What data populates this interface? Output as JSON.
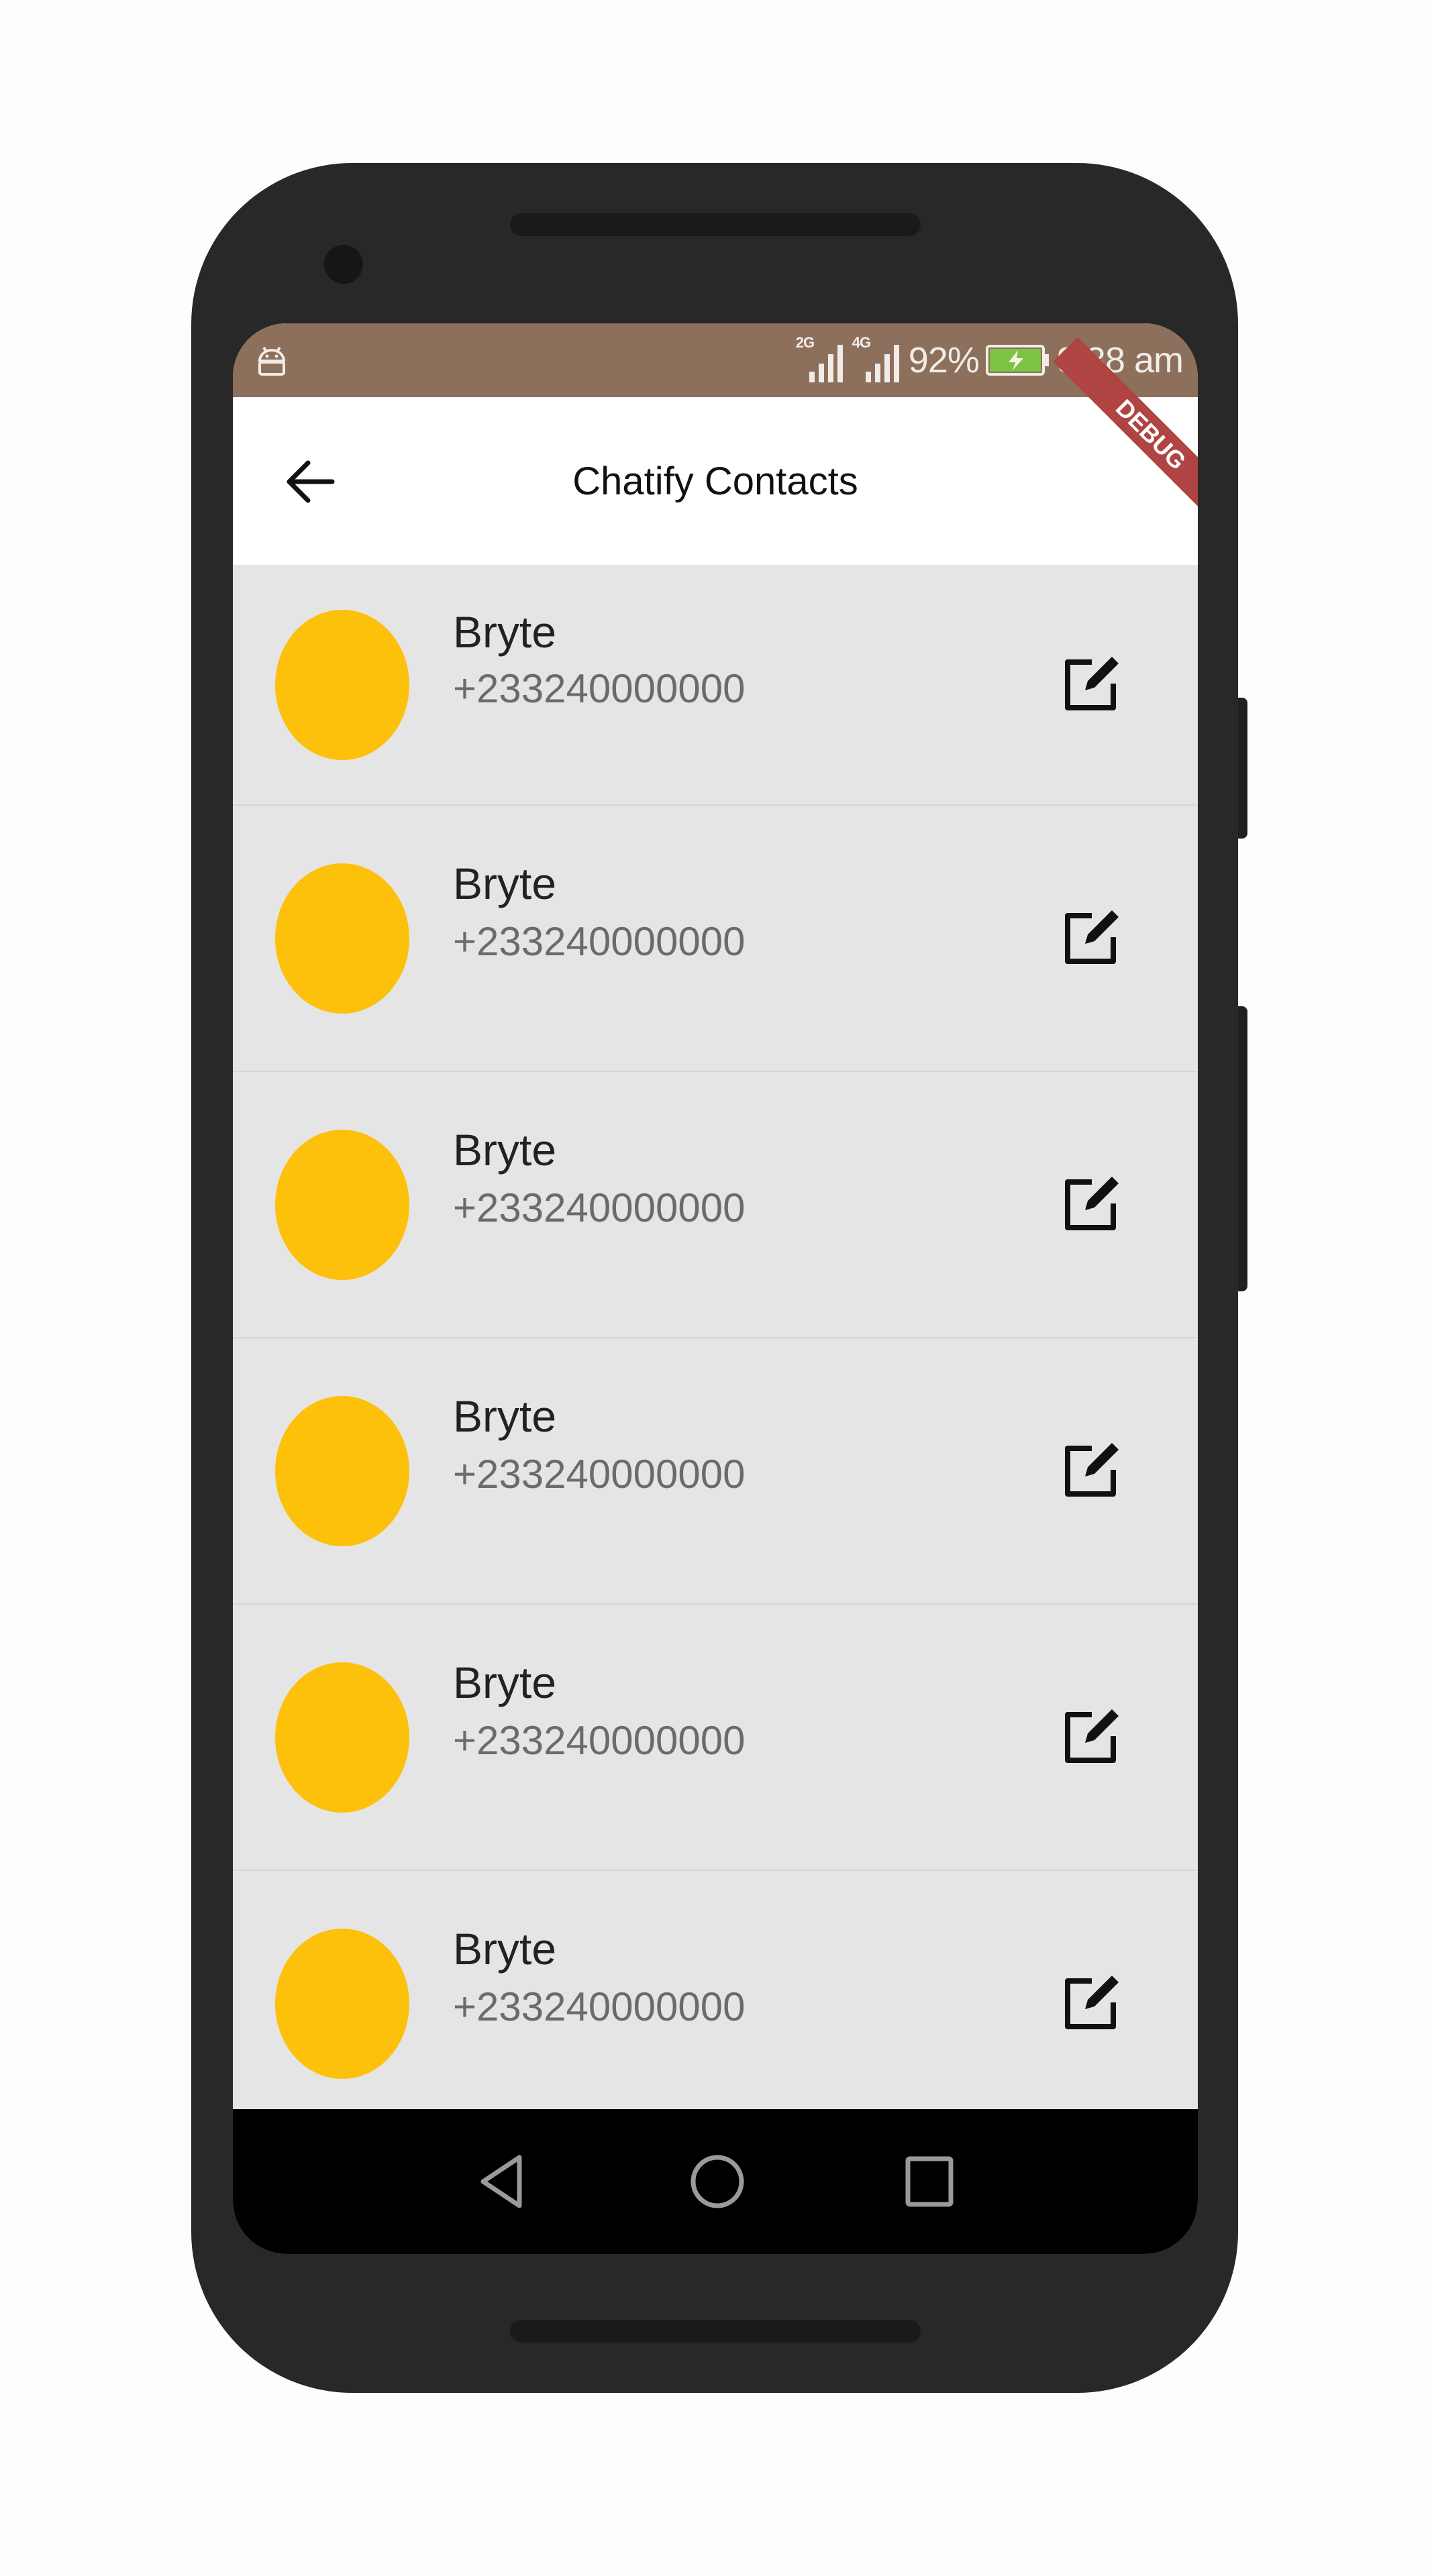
{
  "status_bar": {
    "network1_label": "2G",
    "network2_label": "4G",
    "battery_percent": "92%",
    "time": "9:38 am",
    "icons": [
      "android-icon",
      "signal-icon",
      "signal-icon",
      "battery-charging-icon"
    ]
  },
  "app_bar": {
    "title": "Chatify Contacts",
    "back_icon": "arrow-left-icon",
    "debug_banner": "DEBUG"
  },
  "contacts": [
    {
      "name": "Bryte",
      "phone": "+233240000000"
    },
    {
      "name": "Bryte",
      "phone": "+233240000000"
    },
    {
      "name": "Bryte",
      "phone": "+233240000000"
    },
    {
      "name": "Bryte",
      "phone": "+233240000000"
    },
    {
      "name": "Bryte",
      "phone": "+233240000000"
    },
    {
      "name": "Bryte",
      "phone": "+233240000000"
    }
  ],
  "colors": {
    "status_bar": "#8d705c",
    "avatar": "#fdc00b",
    "list_bg": "#e5e5e5",
    "nav_bar": "#000000",
    "debug_ribbon": "#b04443"
  },
  "nav_bar": {
    "icons": [
      "nav-back-icon",
      "nav-home-icon",
      "nav-recents-icon"
    ]
  }
}
